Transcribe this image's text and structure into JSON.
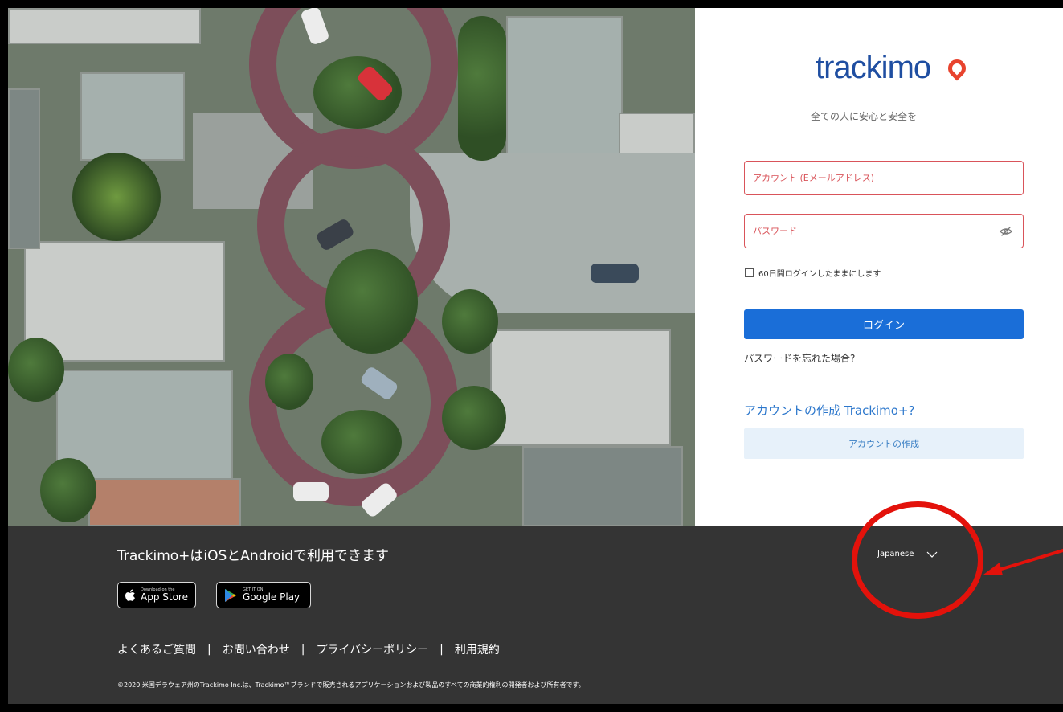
{
  "brand": {
    "logo_text": "trackimo",
    "tagline": "全ての人に安心と安全を"
  },
  "login": {
    "account_placeholder": "アカウント (Eメールアドレス)",
    "password_placeholder": "パスワード",
    "remember_label": "60日間ログインしたままにします",
    "login_button": "ログイン",
    "forgot_link": "パスワードを忘れた場合?",
    "create_prompt": "アカウントの作成 Trackimo+?",
    "create_button": "アカウントの作成"
  },
  "footer": {
    "availability": "Trackimo+はiOSとAndroidで利用できます",
    "app_store": {
      "small": "Download on the",
      "big": "App Store"
    },
    "google_play": {
      "small": "GET IT ON",
      "big": "Google Play"
    },
    "links": [
      "よくあるご質問",
      "お問い合わせ",
      "プライバシーポリシー",
      "利用規約"
    ],
    "separator": "|",
    "copyright": "©2020 米国デラウェア州のTrackimo Inc.は、Trackimo™ブランドで販売されるアプリケーションおよび製品のすべての商業的権利の開発者および所有者です。",
    "language": "Japanese"
  },
  "colors": {
    "primary": "#1a6ed8",
    "error": "#d9545a",
    "footer_bg": "#343434",
    "annotation": "#e3120b"
  },
  "icons": [
    "eye-hidden-icon",
    "apple-icon",
    "google-play-icon",
    "chevron-down-icon"
  ]
}
